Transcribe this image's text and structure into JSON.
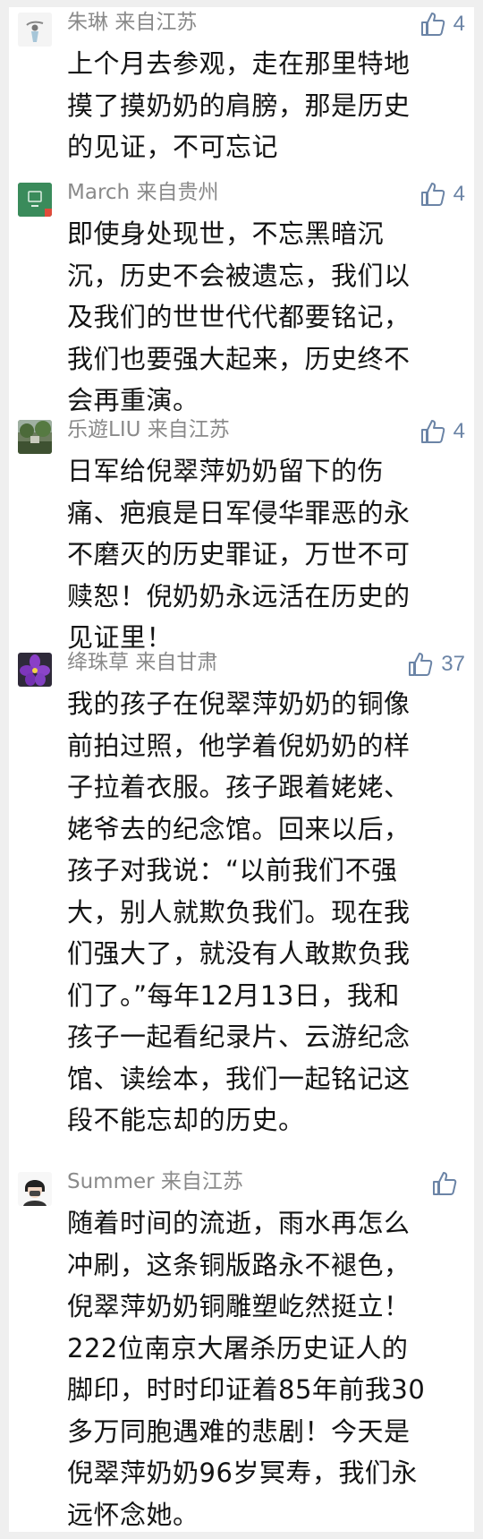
{
  "comments": [
    {
      "user": "朱琳",
      "location": "来自江苏",
      "likes": "4",
      "lines": [
        "上个月去参观，走在那里特地",
        "摸了摸奶奶的肩膀，那是历史",
        "的见证，不可忘记"
      ]
    },
    {
      "user": "March",
      "location": "来自贵州",
      "likes": "4",
      "lines": [
        "即使身处现世，不忘黑暗沉",
        "沉，历史不会被遗忘，我们以",
        "及我们的世世代代都要铭记，",
        "我们也要强大起来，历史终不",
        "会再重演。"
      ]
    },
    {
      "user": "乐遊LIU",
      "location": "来自江苏",
      "likes": "4",
      "lines": [
        "日军给倪翠萍奶奶留下的伤",
        "痛、疤痕是日军侵华罪恶的永",
        "不磨灭的历史罪证，万世不可",
        "赎恕！倪奶奶永远活在历史的",
        "见证里！"
      ]
    },
    {
      "user": "绛珠草",
      "location": "来自甘肃",
      "likes": "37",
      "lines": [
        "我的孩子在倪翠萍奶奶的铜像",
        "前拍过照，他学着倪奶奶的样",
        "子拉着衣服。孩子跟着姥姥、",
        "姥爷去的纪念馆。回来以后，",
        "孩子对我说：“以前我们不强",
        "大，别人就欺负我们。现在我",
        "们强大了，就没有人敢欺负我",
        "们了。”每年12月13日，我和",
        "孩子一起看纪录片、云游纪念",
        "馆、读绘本，我们一起铭记这",
        "段不能忘却的历史。"
      ]
    },
    {
      "user": "Summer",
      "location": "来自江苏",
      "likes": "",
      "lines": [
        "随着时间的流逝，雨水再怎么",
        "冲刷，这条铜版路永不褪色，",
        "倪翠萍奶奶铜雕塑屹然挺立！",
        "222位南京大屠杀历史证人的",
        "脚印，时时印证着85年前我30",
        "多万同胞遇难的悲剧！今天是",
        "倪翠萍奶奶96岁冥寿，我们永",
        "远怀念她。"
      ]
    }
  ]
}
